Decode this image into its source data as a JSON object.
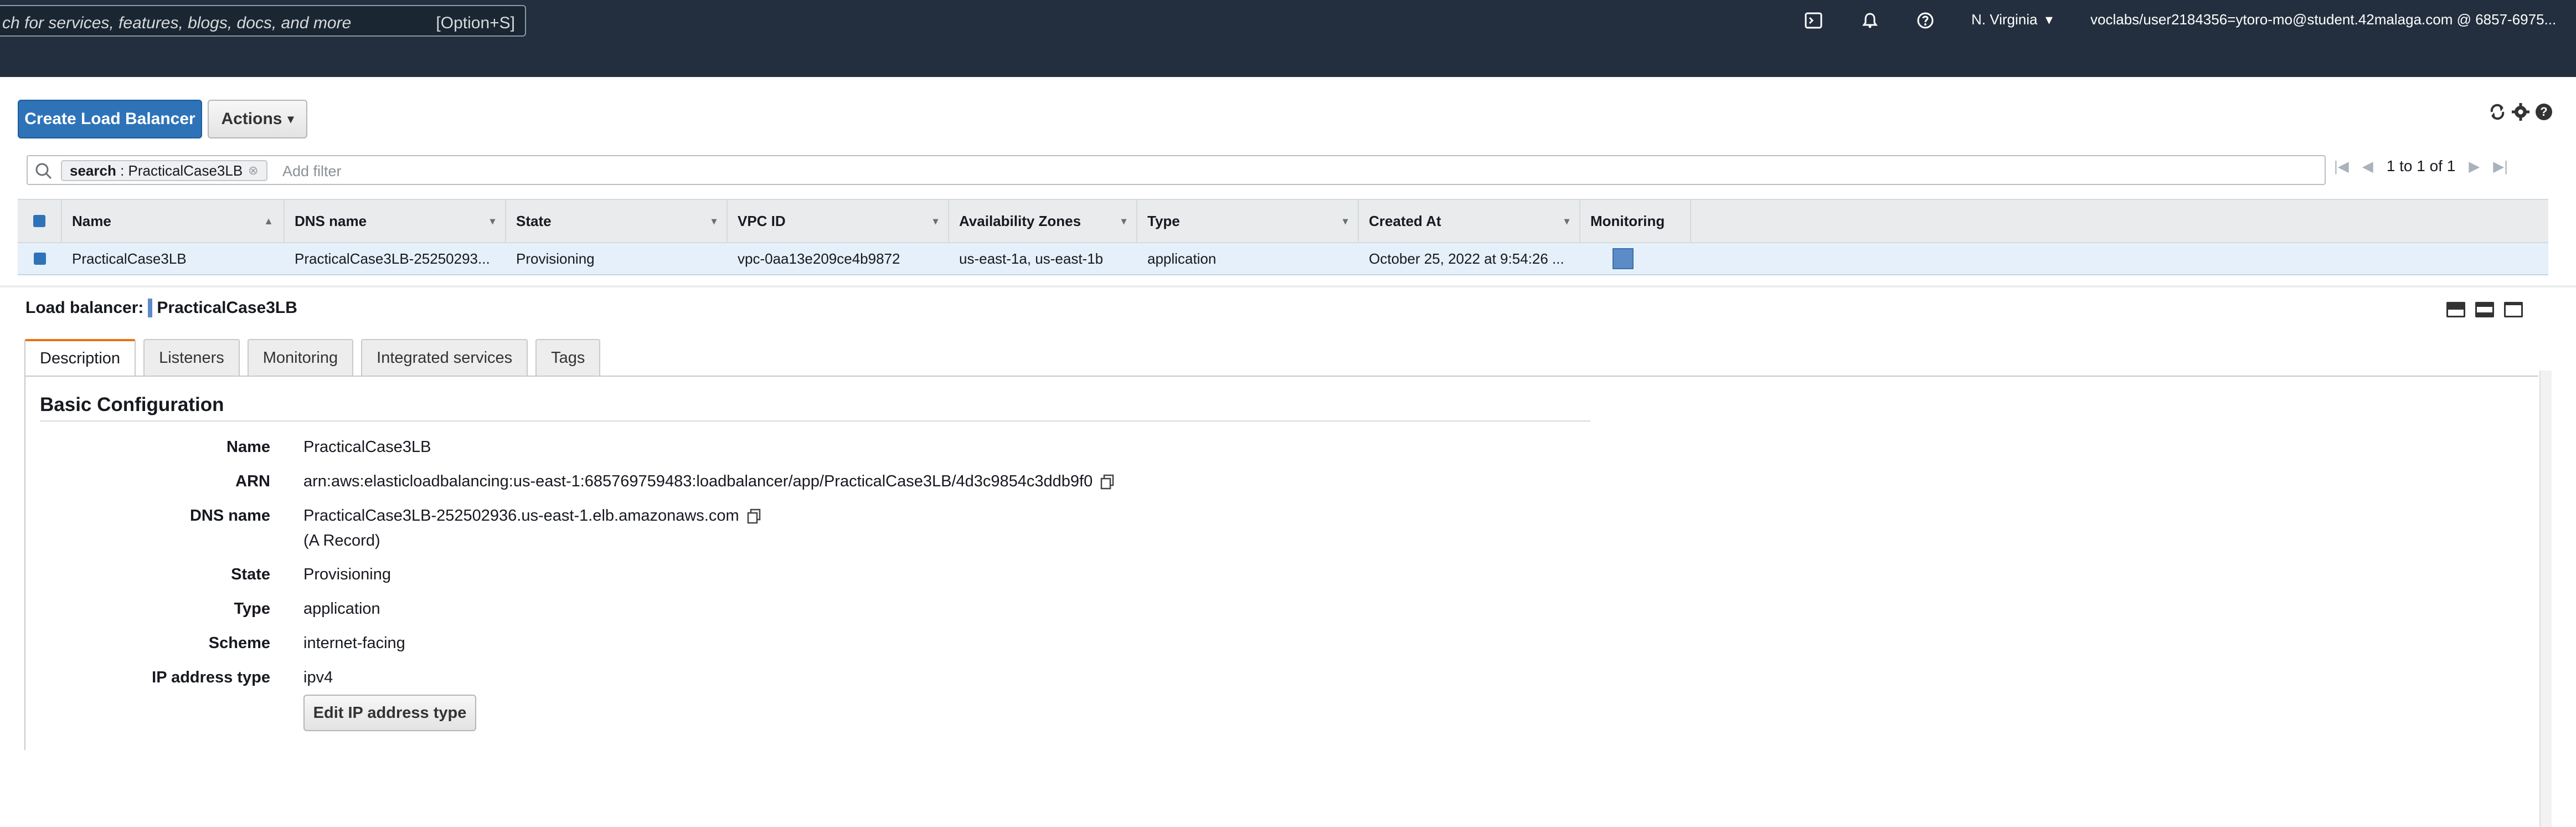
{
  "nav": {
    "search_placeholder": "ch for services, features, blogs, docs, and more",
    "search_shortcut": "[Option+S]",
    "region": "N. Virginia",
    "account": "voclabs/user2184356=ytoro-mo@student.42malaga.com @ 6857-6975..."
  },
  "toolbar": {
    "create_label": "Create Load Balancer",
    "actions_label": "Actions"
  },
  "filter": {
    "token_key": "search",
    "token_value": "PracticalCase3LB",
    "add_placeholder": "Add filter"
  },
  "pager": {
    "range": "1 to 1 of 1"
  },
  "table": {
    "columns": [
      "Name",
      "DNS name",
      "State",
      "VPC ID",
      "Availability Zones",
      "Type",
      "Created At",
      "Monitoring"
    ],
    "rows": [
      {
        "name": "PracticalCase3LB",
        "dns": "PracticalCase3LB-25250293...",
        "state": "Provisioning",
        "vpc": "vpc-0aa13e209ce4b9872",
        "zones": "us-east-1a, us-east-1b",
        "type": "application",
        "created": "October 25, 2022 at 9:54:26 ..."
      }
    ]
  },
  "detail": {
    "heading_label": "Load balancer:",
    "heading_name": "PracticalCase3LB",
    "tabs": [
      "Description",
      "Listeners",
      "Monitoring",
      "Integrated services",
      "Tags"
    ],
    "active_tab": "Description",
    "section_title": "Basic Configuration",
    "fields": {
      "name": {
        "label": "Name",
        "value": "PracticalCase3LB"
      },
      "arn": {
        "label": "ARN",
        "value": "arn:aws:elasticloadbalancing:us-east-1:685769759483:loadbalancer/app/PracticalCase3LB/4d3c9854c3ddb9f0"
      },
      "dns": {
        "label": "DNS name",
        "value": "PracticalCase3LB-252502936.us-east-1.elb.amazonaws.com",
        "note": "(A Record)"
      },
      "state": {
        "label": "State",
        "value": "Provisioning"
      },
      "type": {
        "label": "Type",
        "value": "application"
      },
      "scheme": {
        "label": "Scheme",
        "value": "internet-facing"
      },
      "ip_type": {
        "label": "IP address type",
        "value": "ipv4"
      }
    },
    "edit_ip_label": "Edit IP address type"
  },
  "colors": {
    "nav_bg": "#232f3e",
    "primary": "#2e73b8",
    "selected_row": "#e6f0fa",
    "active_tab_accent": "#ec7211"
  }
}
